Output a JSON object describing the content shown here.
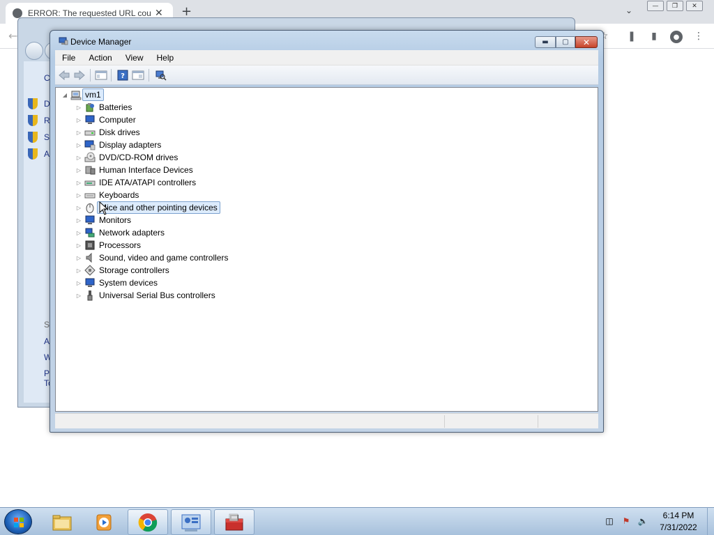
{
  "browser": {
    "tab_title": "ERROR: The requested URL could",
    "tab_close": "✕",
    "new_tab": "+"
  },
  "control_panel": {
    "side_letters": [
      "C",
      "D",
      "R",
      "Sy",
      "A"
    ],
    "lower_letters": [
      "Se",
      "A",
      "W",
      "Pe",
      "To"
    ]
  },
  "device_manager": {
    "title": "Device Manager",
    "menu": [
      "File",
      "Action",
      "View",
      "Help"
    ],
    "root": "vm1",
    "categories": [
      {
        "label": "Batteries",
        "icon": "battery-icon"
      },
      {
        "label": "Computer",
        "icon": "computer-icon"
      },
      {
        "label": "Disk drives",
        "icon": "disk-drive-icon"
      },
      {
        "label": "Display adapters",
        "icon": "display-adapter-icon"
      },
      {
        "label": "DVD/CD-ROM drives",
        "icon": "dvd-drive-icon"
      },
      {
        "label": "Human Interface Devices",
        "icon": "hid-icon"
      },
      {
        "label": "IDE ATA/ATAPI controllers",
        "icon": "ide-controller-icon"
      },
      {
        "label": "Keyboards",
        "icon": "keyboard-icon"
      },
      {
        "label": "Mice and other pointing devices",
        "icon": "mouse-icon"
      },
      {
        "label": "Monitors",
        "icon": "monitor-icon"
      },
      {
        "label": "Network adapters",
        "icon": "network-adapter-icon"
      },
      {
        "label": "Processors",
        "icon": "processor-icon"
      },
      {
        "label": "Sound, video and game controllers",
        "icon": "sound-icon"
      },
      {
        "label": "Storage controllers",
        "icon": "storage-controller-icon"
      },
      {
        "label": "System devices",
        "icon": "system-devices-icon"
      },
      {
        "label": "Universal Serial Bus controllers",
        "icon": "usb-icon"
      }
    ],
    "selected_index": 8
  },
  "taskbar": {
    "time": "6:14 PM",
    "date": "7/31/2022",
    "apps": [
      "file-explorer",
      "media-player",
      "chrome",
      "control-panel",
      "device-manager-toolbox"
    ]
  }
}
